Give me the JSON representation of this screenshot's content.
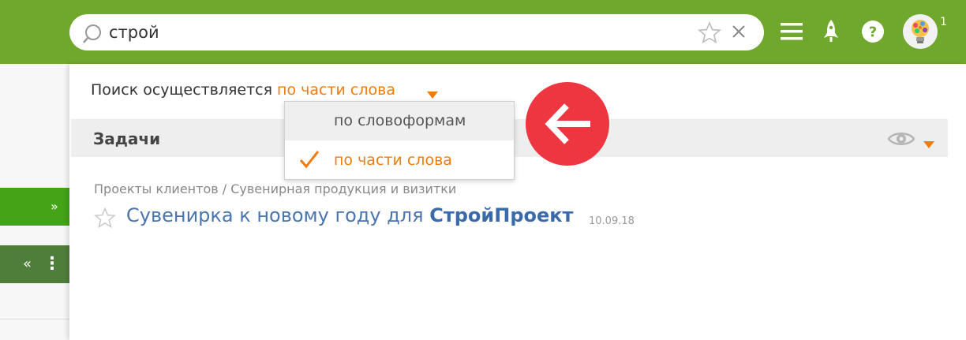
{
  "search": {
    "query": "строй",
    "placeholder": ""
  },
  "header": {
    "notification_count": "1"
  },
  "search_mode": {
    "label": "Поиск осуществляется",
    "selected": "по части слова",
    "options": [
      "по словоформам",
      "по части слова"
    ]
  },
  "section": {
    "title": "Задачи"
  },
  "result": {
    "breadcrumb": "Проекты клиентов / Сувенирная продукция и визитки",
    "title_prefix": "Сувенирка к новому году для ",
    "title_match": "СтройПроект",
    "date": "10.09.18"
  },
  "left_nav": {
    "expand_glyph": "»",
    "collapse_glyph": "«",
    "more_glyph": "⋮"
  },
  "colors": {
    "brand_green": "#70a82e",
    "accent_orange": "#f07c0a",
    "link_blue": "#4a76b0",
    "annotation_red": "#ee3640"
  },
  "icons": [
    "search-icon",
    "star-icon",
    "close-icon",
    "menu-icon",
    "rocket-icon",
    "help-icon",
    "avatar",
    "eye-icon",
    "check-icon",
    "arrow-left-icon"
  ]
}
